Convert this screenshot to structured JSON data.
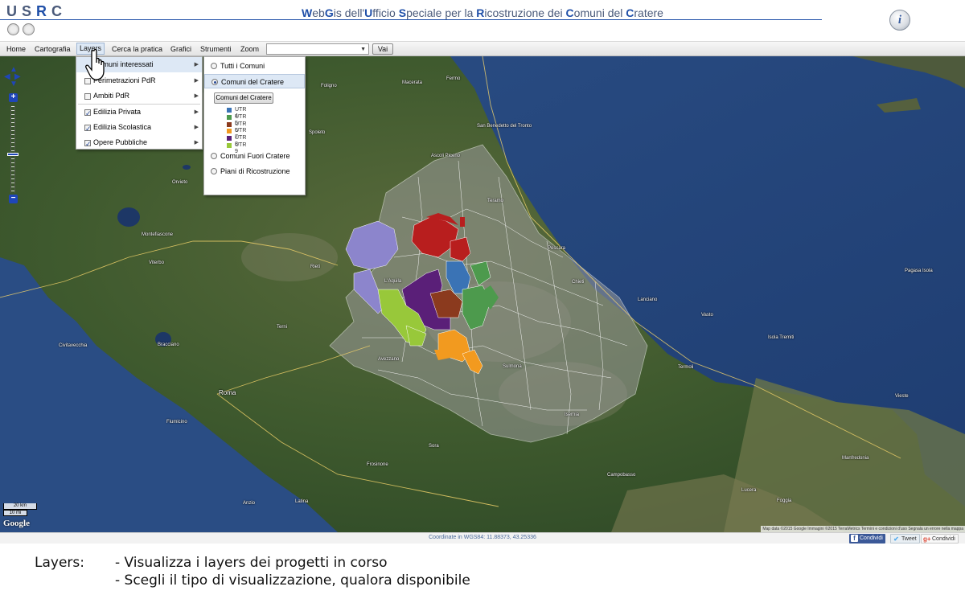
{
  "header": {
    "logo_text": "USRC",
    "title_parts": [
      {
        "text": "W",
        "accent": true
      },
      {
        "text": "eb",
        "accent": false
      },
      {
        "text": "G",
        "accent": true
      },
      {
        "text": "is dell'",
        "accent": false
      },
      {
        "text": "U",
        "accent": true
      },
      {
        "text": "fficio ",
        "accent": false
      },
      {
        "text": "S",
        "accent": true
      },
      {
        "text": "peciale per la ",
        "accent": false
      },
      {
        "text": "R",
        "accent": true
      },
      {
        "text": "icostruzione dei ",
        "accent": false
      },
      {
        "text": "C",
        "accent": true
      },
      {
        "text": "omuni del ",
        "accent": false
      },
      {
        "text": "C",
        "accent": true
      },
      {
        "text": "ratere",
        "accent": false
      }
    ],
    "info_icon_glyph": "i"
  },
  "menubar": {
    "items": [
      "Home",
      "Cartografia",
      "Layers",
      "Cerca la pratica",
      "Grafici",
      "Strumenti",
      "Zoom"
    ],
    "active_item": "Layers",
    "zoom_select_value": "",
    "go_label": "Vai"
  },
  "layers_menu": {
    "items": [
      {
        "label": "Comuni interessati",
        "checked": null,
        "has_submenu": true,
        "highlighted": true
      },
      {
        "label": "Perimetrazioni PdR",
        "checked": false,
        "has_submenu": true,
        "highlighted": false
      },
      {
        "label": "Ambiti PdR",
        "checked": false,
        "has_submenu": true,
        "highlighted": false
      },
      {
        "label": "Edilizia Privata",
        "checked": true,
        "has_submenu": true,
        "highlighted": false
      },
      {
        "label": "Edilizia Scolastica",
        "checked": true,
        "has_submenu": true,
        "highlighted": false
      },
      {
        "label": "Opere Pubbliche",
        "checked": true,
        "has_submenu": true,
        "highlighted": false
      }
    ]
  },
  "sub_menu": {
    "options": [
      {
        "label": "Tutti i Comuni",
        "selected": false
      },
      {
        "label": "Comuni del Cratere",
        "selected": true
      }
    ],
    "button_label": "Comuni del Cratere",
    "legend": [
      {
        "label": "UTR 4",
        "color": "#3a73b5"
      },
      {
        "label": "UTR 5",
        "color": "#4d9a4d"
      },
      {
        "label": "UTR 6",
        "color": "#8b3a1e"
      },
      {
        "label": "UTR 7",
        "color": "#f29a1f"
      },
      {
        "label": "UTR 8",
        "color": "#5a1f78"
      },
      {
        "label": "UTR 9",
        "color": "#98c83a"
      }
    ],
    "options_after": [
      {
        "label": "Comuni Fuori Cratere",
        "selected": false
      },
      {
        "label": "Piani di Ricostruzione",
        "selected": false
      }
    ]
  },
  "map": {
    "places": [
      {
        "name": "San Benedetto del Tronto",
        "big": false
      },
      {
        "name": "Ascoli Piceno",
        "big": false
      },
      {
        "name": "Fermo",
        "big": false
      },
      {
        "name": "Teramo",
        "big": false
      },
      {
        "name": "Pescara",
        "big": false
      },
      {
        "name": "Chieti",
        "big": false
      },
      {
        "name": "Rieti",
        "big": false
      },
      {
        "name": "L'Aquila",
        "big": false
      },
      {
        "name": "Roma",
        "big": true
      },
      {
        "name": "Viterbo",
        "big": false
      },
      {
        "name": "Terni",
        "big": false
      },
      {
        "name": "Termoli",
        "big": false
      },
      {
        "name": "Campobasso",
        "big": false
      },
      {
        "name": "Foggia",
        "big": false
      },
      {
        "name": "Lucera",
        "big": false
      },
      {
        "name": "Vieste",
        "big": false
      },
      {
        "name": "Manfredonia",
        "big": false
      },
      {
        "name": "Isola Tremiti",
        "big": false
      },
      {
        "name": "Isernia",
        "big": false
      },
      {
        "name": "Frosinone",
        "big": false
      },
      {
        "name": "Latina",
        "big": false
      },
      {
        "name": "Civitavecchia",
        "big": false
      },
      {
        "name": "Bracciano",
        "big": false
      },
      {
        "name": "Montefiascone",
        "big": false
      },
      {
        "name": "Orvieto",
        "big": false
      },
      {
        "name": "Spoleto",
        "big": false
      },
      {
        "name": "Foligno",
        "big": false
      },
      {
        "name": "Fiumicino",
        "big": false
      },
      {
        "name": "Anzio",
        "big": false
      },
      {
        "name": "Sora",
        "big": false
      },
      {
        "name": "Avezzano",
        "big": false
      },
      {
        "name": "Sulmona",
        "big": false
      },
      {
        "name": "Vasto",
        "big": false
      },
      {
        "name": "Lanciano",
        "big": false
      },
      {
        "name": "Pagasa Isola",
        "big": false
      },
      {
        "name": "Macerata",
        "big": false
      }
    ],
    "scale_km": "20 km",
    "scale_mi": "10 mi",
    "google_label": "Google",
    "attribution": "Map data ©2015 Google Immagini ©2015 TerraMetrics   Termini e condizioni d'uso   Segnala un errore nella mappa"
  },
  "statusbar": {
    "coords": "Coordinate in WGS84: 11.88373, 43.25336",
    "share": [
      {
        "label": "Condividi",
        "icon": "f"
      },
      {
        "label": "Tweet",
        "icon": "t"
      },
      {
        "label": "Condividi",
        "icon": "g+"
      }
    ]
  },
  "caption": {
    "term": "Layers:",
    "lines": [
      "- Visualizza i layers dei progetti in corso",
      "- Scegli il tipo di visualizzazione, qualora disponibile"
    ]
  }
}
